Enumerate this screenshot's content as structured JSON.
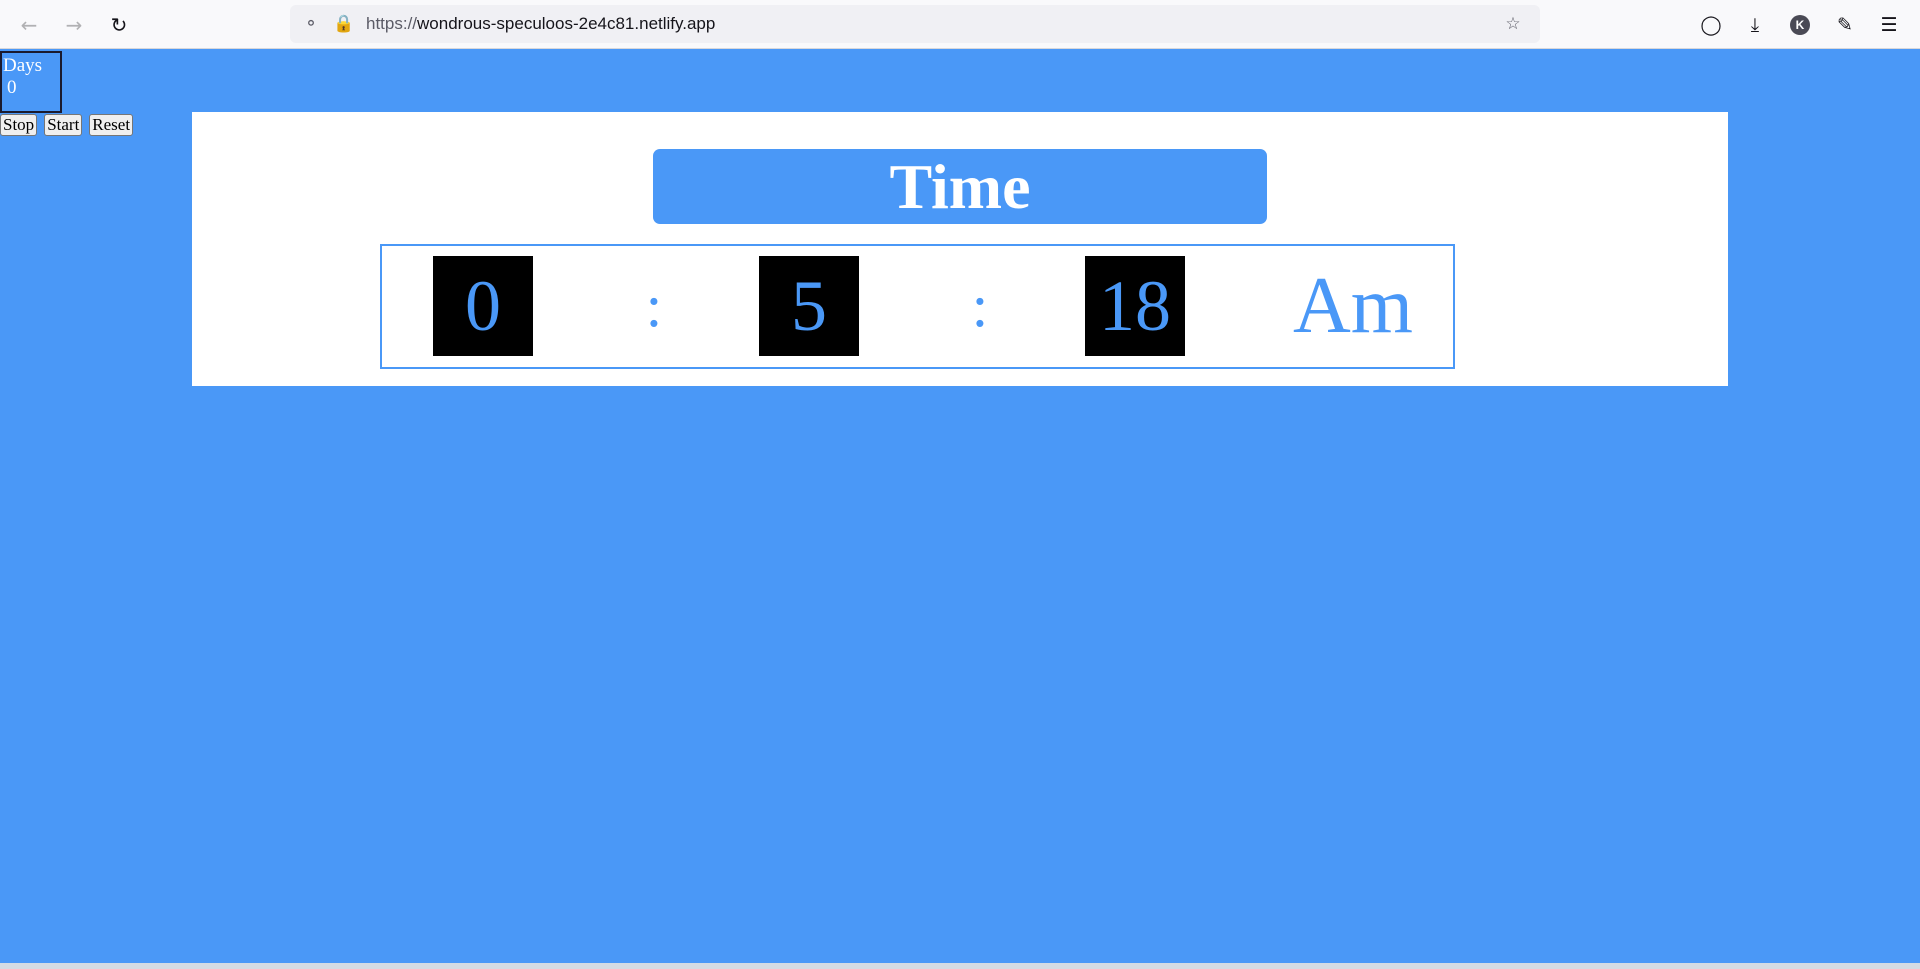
{
  "browser": {
    "url_scheme": "https://",
    "url_host": "wondrous-speculoos-2e4c81.netlify.app",
    "account_initial": "K",
    "icons": {
      "back": "back-arrow-icon",
      "forward": "forward-arrow-icon",
      "reload": "reload-icon",
      "tracking": "shield-icon",
      "lock": "lock-icon",
      "bookmark": "star-icon",
      "pocket": "pocket-icon",
      "downloads": "download-icon",
      "extensions": "puzzle-icon",
      "menu": "hamburger-menu-icon"
    }
  },
  "days": {
    "label": "Days",
    "value": "0"
  },
  "controls": {
    "stop_label": "Stop",
    "start_label": "Start",
    "reset_label": "Reset"
  },
  "clock": {
    "title": "Time",
    "hours": "0",
    "minutes": "5",
    "seconds": "18",
    "separator": ":",
    "meridiem": "Am"
  },
  "colors": {
    "background": "#4a98f7",
    "card": "#ffffff",
    "digit_box": "#000000",
    "accent": "#4a98f7"
  }
}
